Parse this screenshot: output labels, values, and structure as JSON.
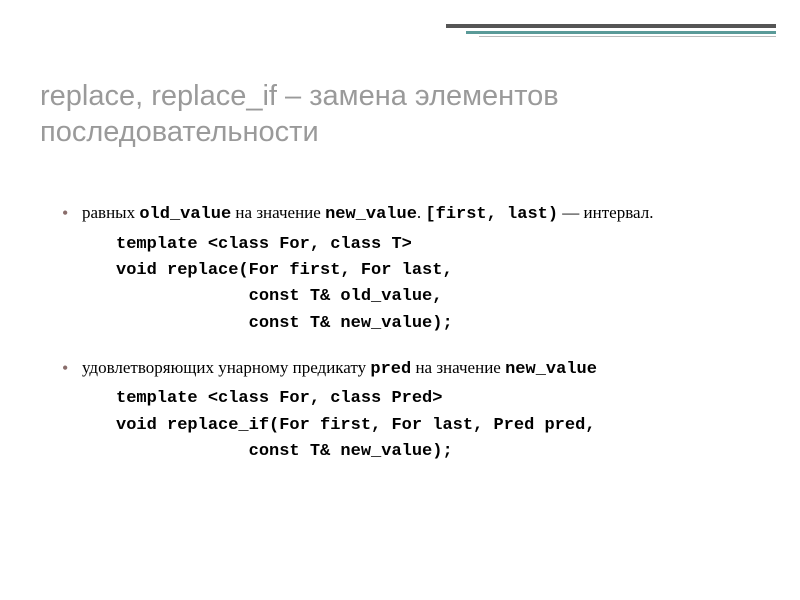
{
  "title": "replace, replace_if – замена элементов последовательности",
  "bullets": [
    {
      "prefix": "равных ",
      "mono1": "old_value",
      "mid": "  на значение ",
      "mono2": "new_value",
      "suffix1": ". ",
      "mono3": "[first, last)",
      "suffix2": " — интервал.",
      "code": [
        "template <class For, class T>",
        "void replace(For first, For last,",
        "             const T& old_value,",
        "             const T& new_value);"
      ]
    },
    {
      "prefix": "удовлетворяющих унарному предикату ",
      "mono1": "pred",
      "mid": "  на значение ",
      "mono2": "new_value",
      "suffix1": "",
      "mono3": "",
      "suffix2": "",
      "code": [
        "template <class For, class Pred>",
        "void replace_if(For first, For last, Pred pred,",
        "             const T& new_value);"
      ]
    }
  ]
}
